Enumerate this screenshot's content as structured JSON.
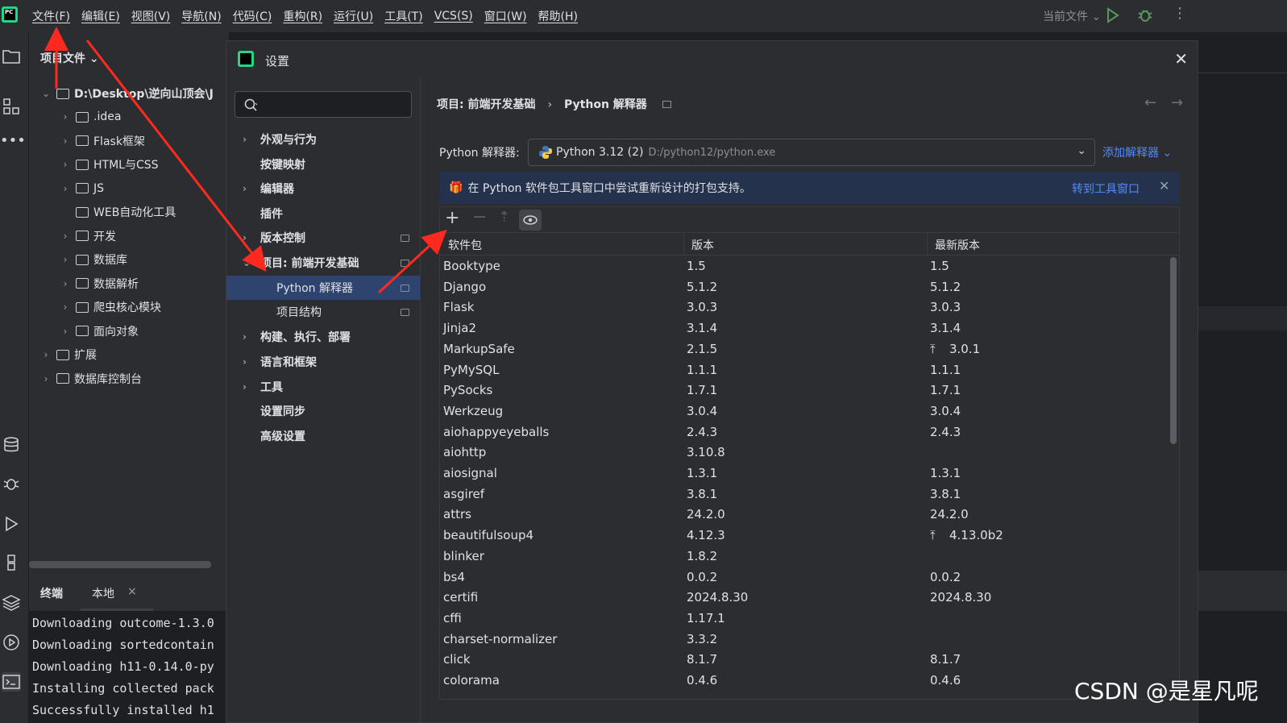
{
  "app": {
    "logo_text": "PC",
    "menu": [
      "文件(F)",
      "编辑(E)",
      "视图(V)",
      "导航(N)",
      "代码(C)",
      "重构(R)",
      "运行(U)",
      "工具(T)",
      "VCS(S)",
      "窗口(W)",
      "帮助(H)"
    ],
    "run_config": "当前文件"
  },
  "project": {
    "title": "项目文件",
    "root": "D:\\Desktop\\逆向山顶会\\J",
    "items": [
      ".idea",
      "Flask框架",
      "HTML与CSS",
      "JS",
      "WEB自动化工具",
      "开发",
      "数据库",
      "数据解析",
      "爬虫核心模块",
      "面向对象"
    ],
    "external": [
      "扩展",
      "数据库控制台"
    ]
  },
  "terminal": {
    "tab_title": "终端",
    "tab_local": "本地",
    "lines": [
      "Downloading outcome-1.3.0",
      "Downloading sortedcontain",
      "Downloading h11-0.14.0-py",
      "Installing collected pack",
      "Successfully installed h1"
    ]
  },
  "dialog": {
    "title": "设置",
    "search_placeholder": "",
    "nav": [
      "外观与行为",
      "按键映射",
      "编辑器",
      "插件",
      "版本控制",
      "项目: 前端开发基础",
      "Python 解释器",
      "项目结构",
      "构建、执行、部署",
      "语言和框架",
      "工具",
      "设置同步",
      "高级设置"
    ],
    "breadcrumb_project": "项目: 前端开发基础",
    "breadcrumb_sep": "›",
    "breadcrumb_page": "Python 解释器",
    "interpreter_label": "Python 解释器:",
    "interpreter_name": "Python 3.12 (2)",
    "interpreter_path": "D:/python12/python.exe",
    "add_interpreter": "添加解释器",
    "banner_text": "在 Python 软件包工具窗口中尝试重新设计的打包支持。",
    "banner_link": "转到工具窗口",
    "columns": [
      "软件包",
      "版本",
      "最新版本"
    ],
    "packages": [
      {
        "name": "Booktype",
        "version": "1.5",
        "latest": "1.5",
        "upgrade": false
      },
      {
        "name": "Django",
        "version": "5.1.2",
        "latest": "5.1.2",
        "upgrade": false
      },
      {
        "name": "Flask",
        "version": "3.0.3",
        "latest": "3.0.3",
        "upgrade": false
      },
      {
        "name": "Jinja2",
        "version": "3.1.4",
        "latest": "3.1.4",
        "upgrade": false
      },
      {
        "name": "MarkupSafe",
        "version": "2.1.5",
        "latest": "3.0.1",
        "upgrade": true
      },
      {
        "name": "PyMySQL",
        "version": "1.1.1",
        "latest": "1.1.1",
        "upgrade": false
      },
      {
        "name": "PySocks",
        "version": "1.7.1",
        "latest": "1.7.1",
        "upgrade": false
      },
      {
        "name": "Werkzeug",
        "version": "3.0.4",
        "latest": "3.0.4",
        "upgrade": false
      },
      {
        "name": "aiohappyeyeballs",
        "version": "2.4.3",
        "latest": "2.4.3",
        "upgrade": false
      },
      {
        "name": "aiohttp",
        "version": "3.10.8",
        "latest": "",
        "upgrade": false
      },
      {
        "name": "aiosignal",
        "version": "1.3.1",
        "latest": "1.3.1",
        "upgrade": false
      },
      {
        "name": "asgiref",
        "version": "3.8.1",
        "latest": "3.8.1",
        "upgrade": false
      },
      {
        "name": "attrs",
        "version": "24.2.0",
        "latest": "24.2.0",
        "upgrade": false
      },
      {
        "name": "beautifulsoup4",
        "version": "4.12.3",
        "latest": "4.13.0b2",
        "upgrade": true
      },
      {
        "name": "blinker",
        "version": "1.8.2",
        "latest": "",
        "upgrade": false
      },
      {
        "name": "bs4",
        "version": "0.0.2",
        "latest": "0.0.2",
        "upgrade": false
      },
      {
        "name": "certifi",
        "version": "2024.8.30",
        "latest": "2024.8.30",
        "upgrade": false
      },
      {
        "name": "cffi",
        "version": "1.17.1",
        "latest": "",
        "upgrade": false
      },
      {
        "name": "charset-normalizer",
        "version": "3.3.2",
        "latest": "",
        "upgrade": false
      },
      {
        "name": "click",
        "version": "8.1.7",
        "latest": "8.1.7",
        "upgrade": false
      },
      {
        "name": "colorama",
        "version": "0.4.6",
        "latest": "0.4.6",
        "upgrade": false
      }
    ]
  },
  "watermark": "CSDN @是星凡呢",
  "colors": {
    "accent": "#548af7",
    "selection": "#2e436e",
    "annotation_arrow": "#ff2a1f"
  }
}
